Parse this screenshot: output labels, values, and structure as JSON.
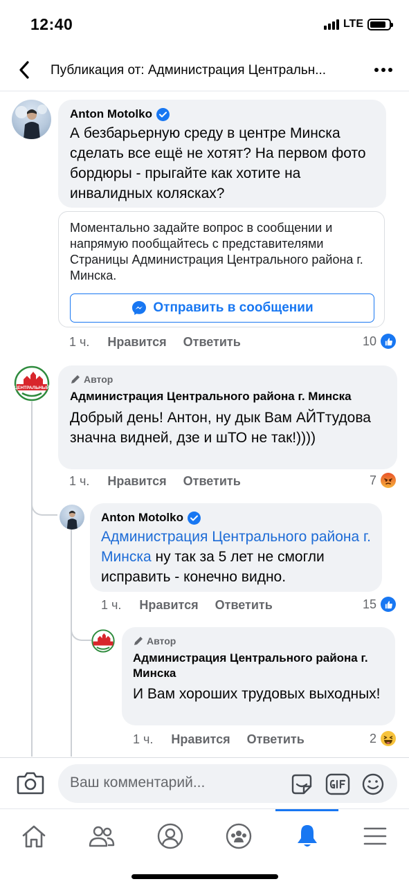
{
  "status_bar": {
    "time": "12:40",
    "network": "LTE",
    "battery_level": 0.85
  },
  "header": {
    "title": "Публикация от: Администрация Центральн..."
  },
  "comments": [
    {
      "author": "Anton Motolko",
      "verified": true,
      "text": "А безбарьерную среду в центре Минска сделать все ещё не хотят? На первом фото бордюры - прыгайте как хотите на инвалидных колясках?",
      "message_card": {
        "text": "Моментально задайте вопрос в сообщении и напрямую пообщайтесь с представителями Страницы Администрация Центрального района г. Минска.",
        "button_label": "Отправить в сообщении"
      },
      "time": "1 ч.",
      "like_label": "Нравится",
      "reply_label": "Ответить",
      "reaction_count": "10",
      "reaction_icon": "like-icon"
    },
    {
      "badge": "Автор",
      "author": "Администрация Центрального района г. Минска",
      "avatar_text": "ЦЕНТРАЛЬНЫЙ",
      "text": "Добрый день! Антон, ну дык Вам АЙТтудова значна видней, дзе и шТО не так!))))",
      "time": "1 ч.",
      "like_label": "Нравится",
      "reply_label": "Ответить",
      "reaction_count": "7",
      "reaction_icon": "angry-icon"
    },
    {
      "author": "Anton Motolko",
      "verified": true,
      "mention": "Администрация Центрального района г. Минска",
      "text": " ну так за 5 лет не смогли исправить - конечно видно.",
      "time": "1 ч.",
      "like_label": "Нравится",
      "reply_label": "Ответить",
      "reaction_count": "15",
      "reaction_icon": "like-icon"
    },
    {
      "badge": "Автор",
      "author": "Администрация Центрального района г. Минска",
      "text": "И Вам хороших трудовых выходных!",
      "time": "1 ч.",
      "like_label": "Нравится",
      "reply_label": "Ответить",
      "reaction_count": "2",
      "reaction_icon": "haha-icon"
    }
  ],
  "composer": {
    "placeholder": "Ваш комментарий..."
  },
  "tabbar": {
    "items": [
      "home-icon",
      "friends-icon",
      "profile-icon",
      "groups-icon",
      "notifications-icon",
      "menu-icon"
    ],
    "active": "notifications-icon"
  },
  "colors": {
    "accent": "#1877f2",
    "bubble": "#f0f2f5",
    "secondary_text": "#65676b",
    "mention": "#1c6bd6"
  }
}
